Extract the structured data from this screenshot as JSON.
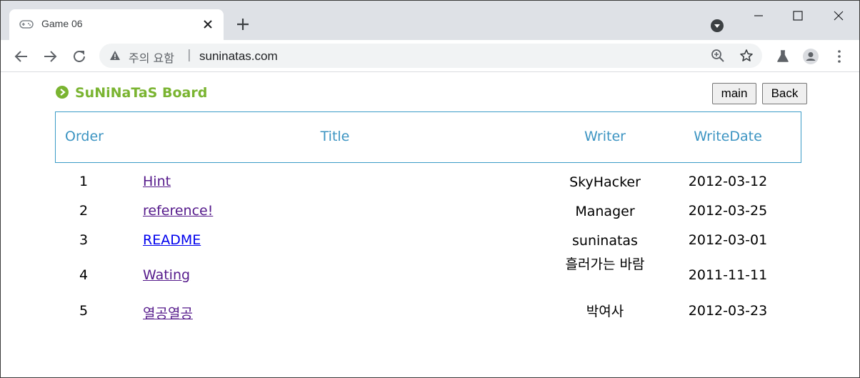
{
  "browser": {
    "tab_title": "Game 06",
    "security_label": "주의 요함",
    "url": "suninatas.com"
  },
  "page": {
    "board_title": "SuNiNaTaS Board",
    "buttons": {
      "main": "main",
      "back": "Back"
    },
    "columns": [
      "Order",
      "Title",
      "Writer",
      "WriteDate"
    ],
    "rows": [
      {
        "order": "1",
        "title": "Hint",
        "writer": "SkyHacker",
        "date": "2012-03-12",
        "visited": true
      },
      {
        "order": "2",
        "title": "reference!",
        "writer": "Manager",
        "date": "2012-03-25",
        "visited": true
      },
      {
        "order": "3",
        "title": "README",
        "writer": "suninatas",
        "date": "2012-03-01",
        "visited": false
      },
      {
        "order": "4",
        "title": "Wating",
        "writer": "흘러가는 바람",
        "date": "2011-11-11",
        "visited": true
      },
      {
        "order": "5",
        "title": "열공열공",
        "writer": "박여사",
        "date": "2012-03-23",
        "visited": true
      }
    ]
  },
  "colors": {
    "board_title": "#7ab431",
    "header_text": "#3c94c2",
    "table_border": "#3b9bc7",
    "visited_link": "#551a8b",
    "unvisited_link": "#0000ee"
  }
}
